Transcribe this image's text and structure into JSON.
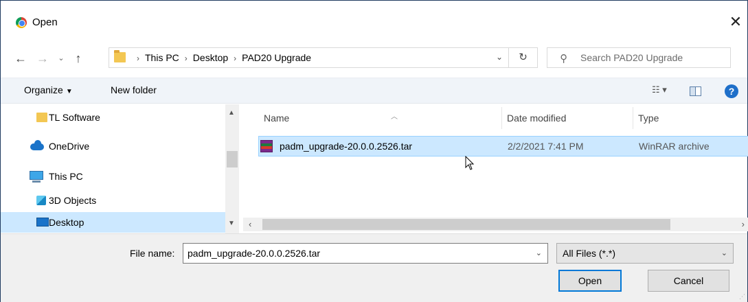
{
  "window": {
    "title": "Open",
    "app_icon": "chrome-icon",
    "close_glyph": "✕"
  },
  "nav": {
    "back_glyph": "←",
    "forward_glyph": "→",
    "recent_glyph": "⌄",
    "up_glyph": "↑",
    "breadcrumbs": [
      "This PC",
      "Desktop",
      "PAD20 Upgrade"
    ],
    "crumb_separator": "›",
    "refresh_glyph": "↻",
    "search_placeholder": "Search PAD20 Upgrade"
  },
  "toolbar": {
    "organize_label": "Organize",
    "new_folder_label": "New folder",
    "help_glyph": "?"
  },
  "sidebar": {
    "items": [
      {
        "label": "TL Software",
        "icon": "folder-icon"
      },
      {
        "label": "OneDrive",
        "icon": "onedrive-icon"
      },
      {
        "label": "This PC",
        "icon": "computer-icon"
      },
      {
        "label": "3D Objects",
        "icon": "3d-objects-icon"
      },
      {
        "label": "Desktop",
        "icon": "desktop-icon",
        "selected": true
      }
    ]
  },
  "file_list": {
    "columns": [
      "Name",
      "Date modified",
      "Type"
    ],
    "rows": [
      {
        "name": "padm_upgrade-20.0.0.2526.tar",
        "date_modified": "2/2/2021 7:41 PM",
        "type": "WinRAR archive",
        "icon": "winrar-archive-icon",
        "selected": true
      }
    ]
  },
  "footer": {
    "file_name_label": "File name:",
    "file_name_value": "padm_upgrade-20.0.0.2526.tar",
    "file_type_value": "All Files (*.*)",
    "open_label": "Open",
    "cancel_label": "Cancel"
  },
  "colors": {
    "selection_bg": "#cce8ff",
    "accent": "#0078d7",
    "toolbar_bg": "#f0f4f9",
    "footer_bg": "#f0f0f0"
  }
}
